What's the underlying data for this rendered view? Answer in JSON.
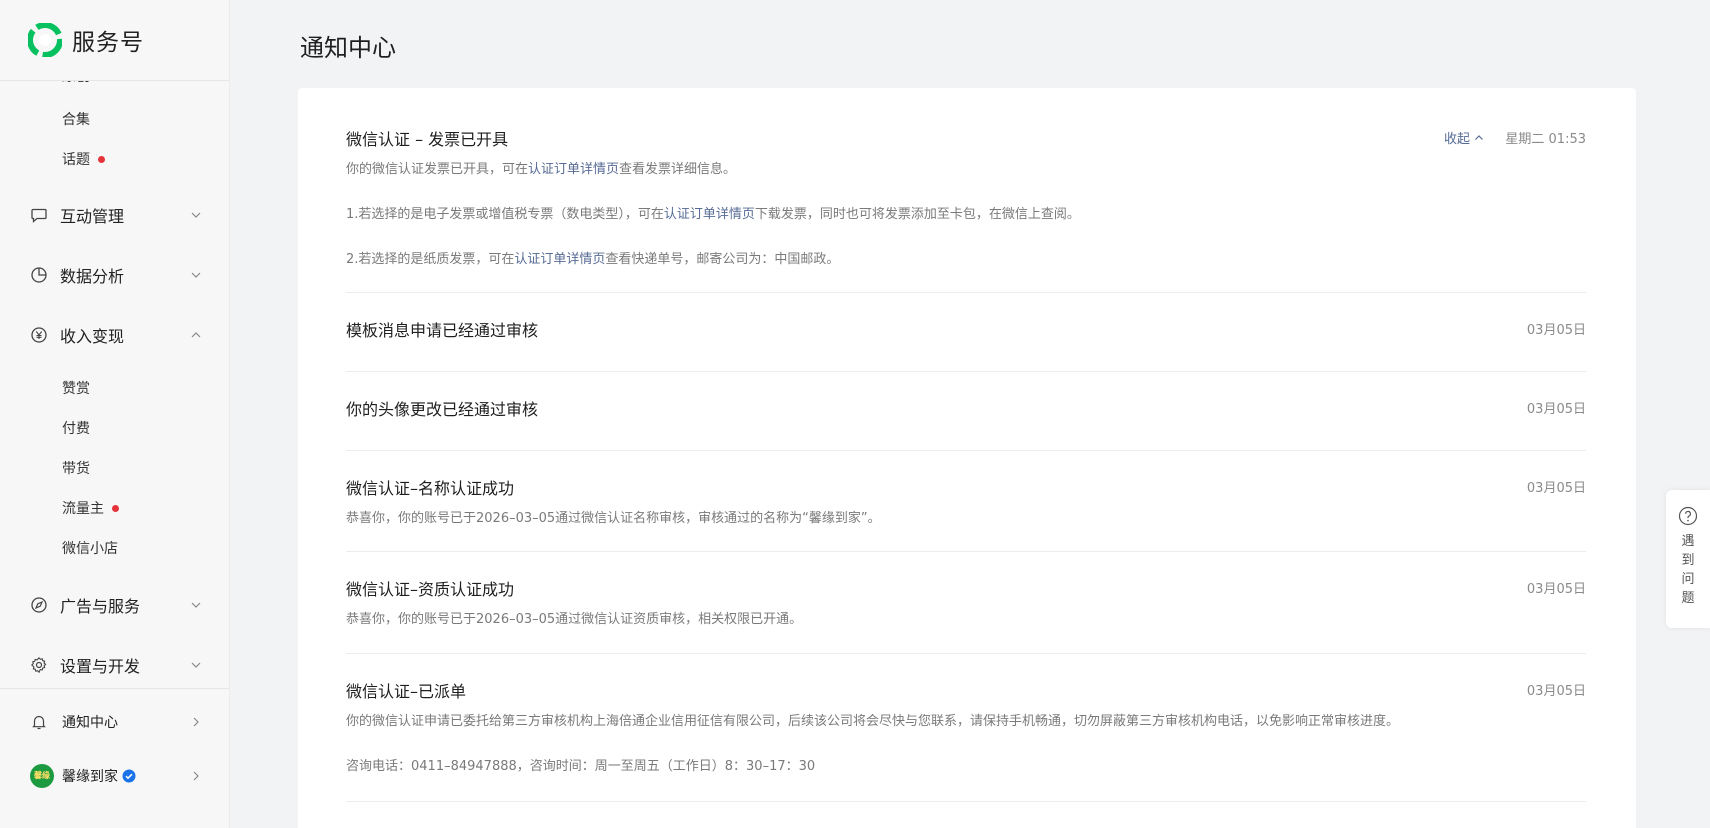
{
  "brand": {
    "name": "服务号"
  },
  "sidebar": {
    "cut_item": "原创",
    "sub_items_top": [
      {
        "label": "合集",
        "dot": false
      },
      {
        "label": "话题",
        "dot": true
      }
    ],
    "groups": [
      {
        "label": "互动管理",
        "icon": "chat-bubble-icon",
        "expanded": false
      },
      {
        "label": "数据分析",
        "icon": "pie-chart-icon",
        "expanded": false
      },
      {
        "label": "收入变现",
        "icon": "yen-circle-icon",
        "expanded": true
      },
      {
        "label": "广告与服务",
        "icon": "compass-icon",
        "expanded": false
      },
      {
        "label": "设置与开发",
        "icon": "gear-icon",
        "expanded": false
      }
    ],
    "monetize_items": [
      {
        "label": "赞赏",
        "dot": false
      },
      {
        "label": "付费",
        "dot": false
      },
      {
        "label": "带货",
        "dot": false
      },
      {
        "label": "流量主",
        "dot": true
      },
      {
        "label": "微信小店",
        "dot": false
      }
    ],
    "footer": {
      "notify": "通知中心",
      "account": "馨缘到家",
      "avatar_text": "馨缘"
    }
  },
  "main": {
    "title": "通知中心",
    "notices": [
      {
        "title": "微信认证 – 发票已开具",
        "date": "星期二 01:53",
        "collapse_label": "收起",
        "line1_pre": "你的微信认证发票已开具，可在",
        "line1_link": "认证订单详情页",
        "line1_post": "查看发票详细信息。",
        "line2_pre": "1.若选择的是电子发票或增值税专票（数电类型），可在",
        "line2_link": "认证订单详情页",
        "line2_post": "下载发票，同时也可将发票添加至卡包，在微信上查阅。",
        "line3_pre": "2.若选择的是纸质发票，可在",
        "line3_link": "认证订单详情页",
        "line3_post": "查看快递单号，邮寄公司为：中国邮政。"
      },
      {
        "title": "模板消息申请已经通过审核",
        "date": "03月05日"
      },
      {
        "title": "你的头像更改已经通过审核",
        "date": "03月05日"
      },
      {
        "title": "微信认证–名称认证成功",
        "date": "03月05日",
        "body": "恭喜你，你的账号已于2026–03–05通过微信认证名称审核，审核通过的名称为“馨缘到家”。"
      },
      {
        "title": "微信认证–资质认证成功",
        "date": "03月05日",
        "body": "恭喜你，你的账号已于2026–03–05通过微信认证资质审核，相关权限已开通。"
      },
      {
        "title": "微信认证–已派单",
        "date": "03月05日",
        "body": "你的微信认证申请已委托给第三方审核机构上海倍通企业信用征信有限公司，后续该公司将会尽快与您联系，请保持手机畅通，切勿屏蔽第三方审核机构电话，以免影响正常审核进度。",
        "body2": "咨询电话：0411–84947888，咨询时间：周一至周五（工作日）8：30–17：30"
      }
    ]
  },
  "help": {
    "label": "遇到问题"
  },
  "colors": {
    "brand_green": "#07c160",
    "link": "#576b95",
    "dot_red": "#e5333a"
  }
}
